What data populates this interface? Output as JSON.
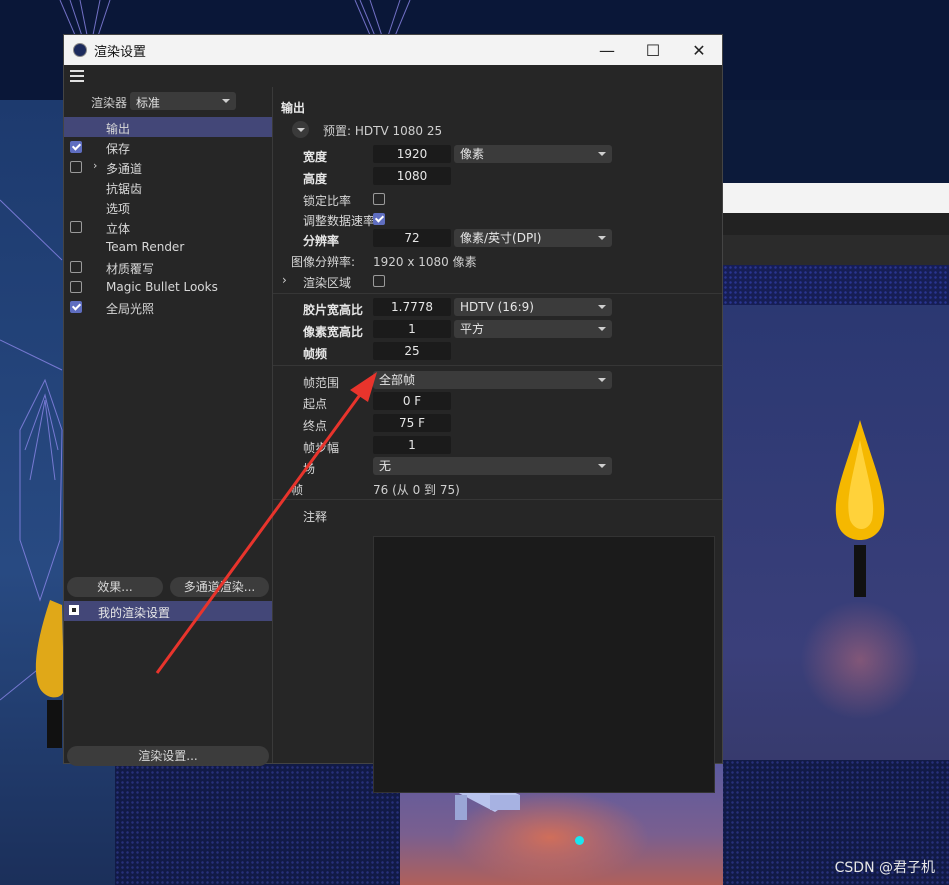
{
  "window": {
    "title": "渲染设置",
    "controls": {
      "minimize": "—",
      "maximize": "☐",
      "close": "✕"
    }
  },
  "left_panel": {
    "renderer_label": "渲染器",
    "renderer_value": "标准",
    "tree": [
      {
        "label": "输出",
        "checkbox": null,
        "checked": false,
        "expander": false,
        "selected": true
      },
      {
        "label": "保存",
        "checkbox": true,
        "checked": true,
        "expander": false,
        "selected": false
      },
      {
        "label": "多通道",
        "checkbox": true,
        "checked": false,
        "expander": true,
        "selected": false
      },
      {
        "label": "抗锯齿",
        "checkbox": null,
        "checked": false,
        "expander": false,
        "selected": false
      },
      {
        "label": "选项",
        "checkbox": null,
        "checked": false,
        "expander": false,
        "selected": false
      },
      {
        "label": "立体",
        "checkbox": true,
        "checked": false,
        "expander": false,
        "selected": false
      },
      {
        "label": "Team Render",
        "checkbox": null,
        "checked": false,
        "expander": false,
        "selected": false
      },
      {
        "label": "材质覆写",
        "checkbox": true,
        "checked": false,
        "expander": false,
        "selected": false
      },
      {
        "label": "Magic Bullet Looks",
        "checkbox": true,
        "checked": false,
        "expander": false,
        "selected": false
      },
      {
        "label": "全局光照",
        "checkbox": true,
        "checked": true,
        "expander": false,
        "selected": false
      }
    ],
    "effects_button": "效果...",
    "multipass_button": "多通道渲染...",
    "preset_item": "我的渲染设置",
    "render_settings_button": "渲染设置..."
  },
  "output": {
    "section_title": "输出",
    "preset": "预置: HDTV 1080 25",
    "width_label": "宽度",
    "width_value": "1920",
    "width_unit": "像素",
    "height_label": "高度",
    "height_value": "1080",
    "lock_ratio_label": "锁定比率",
    "lock_ratio_checked": false,
    "adjust_rate_label": "调整数据速率",
    "adjust_rate_checked": true,
    "resolution_label": "分辨率",
    "resolution_value": "72",
    "resolution_unit": "像素/英寸(DPI)",
    "image_res_label": "图像分辨率:",
    "image_res_value": "1920 x 1080 像素",
    "render_region_label": "渲染区域",
    "render_region_checked": false,
    "film_aspect_label": "胶片宽高比",
    "film_aspect_value": "1.7778",
    "film_aspect_preset": "HDTV (16:9)",
    "pixel_aspect_label": "像素宽高比",
    "pixel_aspect_value": "1",
    "pixel_aspect_preset": "平方",
    "fps_label": "帧频",
    "fps_value": "25",
    "frame_range_label": "帧范围",
    "frame_range_value": "全部帧",
    "start_label": "起点",
    "start_value": "0 F",
    "end_label": "终点",
    "end_value": "75 F",
    "frame_step_label": "帧步幅",
    "frame_step_value": "1",
    "fields_label": "场",
    "fields_value": "无",
    "frames_label": "帧",
    "frames_value": "76 (从 0 到 75)",
    "notes_label": "注释"
  },
  "watermark": "CSDN @君子机",
  "colors": {
    "accent": "#434778",
    "check": "#5f6ec0",
    "annotation_arrow": "#e8342c"
  }
}
